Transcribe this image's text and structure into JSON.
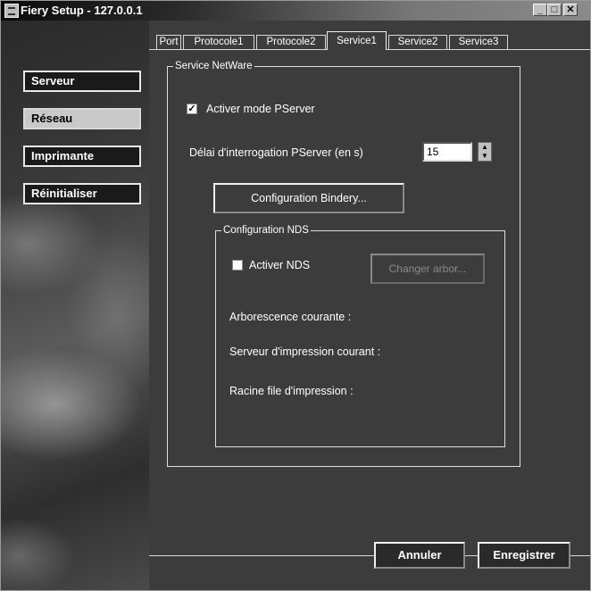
{
  "window": {
    "title": "Fiery Setup - 127.0.0.1",
    "controls": {
      "minimize": "_",
      "maximize": "□",
      "close": "✕"
    }
  },
  "sidebar": {
    "items": [
      {
        "label": "Serveur",
        "active": false
      },
      {
        "label": "Réseau",
        "active": true
      },
      {
        "label": "Imprimante",
        "active": false
      },
      {
        "label": "Réinitialiser",
        "active": false
      }
    ]
  },
  "tabs": [
    {
      "label": "Port",
      "active": false
    },
    {
      "label": "Protocole1",
      "active": false
    },
    {
      "label": "Protocole2",
      "active": false
    },
    {
      "label": "Service1",
      "active": true
    },
    {
      "label": "Service2",
      "active": false
    },
    {
      "label": "Service3",
      "active": false
    }
  ],
  "netware": {
    "group_label": "Service NetWare",
    "pserver_checkbox_label": "Activer mode PServer",
    "pserver_checked": true,
    "poll_label": "Délai d'interrogation PServer (en s)",
    "poll_value": "15",
    "bindery_button": "Configuration Bindery...",
    "nds": {
      "group_label": "Configuration NDS",
      "enable_label": "Activer NDS",
      "enable_checked": false,
      "change_tree_button": "Changer arbor...",
      "current_tree_label": "Arborescence courante :",
      "current_server_label": "Serveur d'impression courant :",
      "queue_root_label": "Racine file d'impression :"
    }
  },
  "footer": {
    "cancel_label": "Annuler",
    "save_label": "Enregistrer"
  }
}
